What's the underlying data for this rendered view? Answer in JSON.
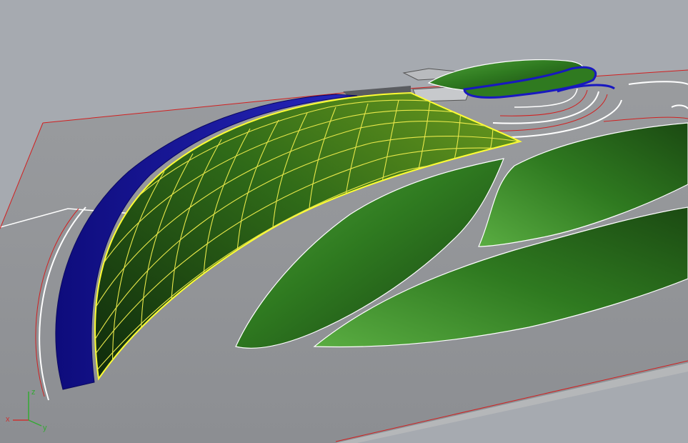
{
  "viewport": {
    "colors": {
      "background": "#a6aab0",
      "ground": "#8f9194",
      "blue_surface": "#17169c",
      "mesh_highlight": "#ffff33",
      "green_dark": "#1b4a12",
      "green_mid": "#2f7a20",
      "green_light": "#4fa33a"
    },
    "axis": {
      "x_label": "x",
      "y_label": "y",
      "z_label": "z",
      "x_color": "#cc3333",
      "y_color": "#33aa33",
      "z_color": "#33aa33"
    }
  }
}
